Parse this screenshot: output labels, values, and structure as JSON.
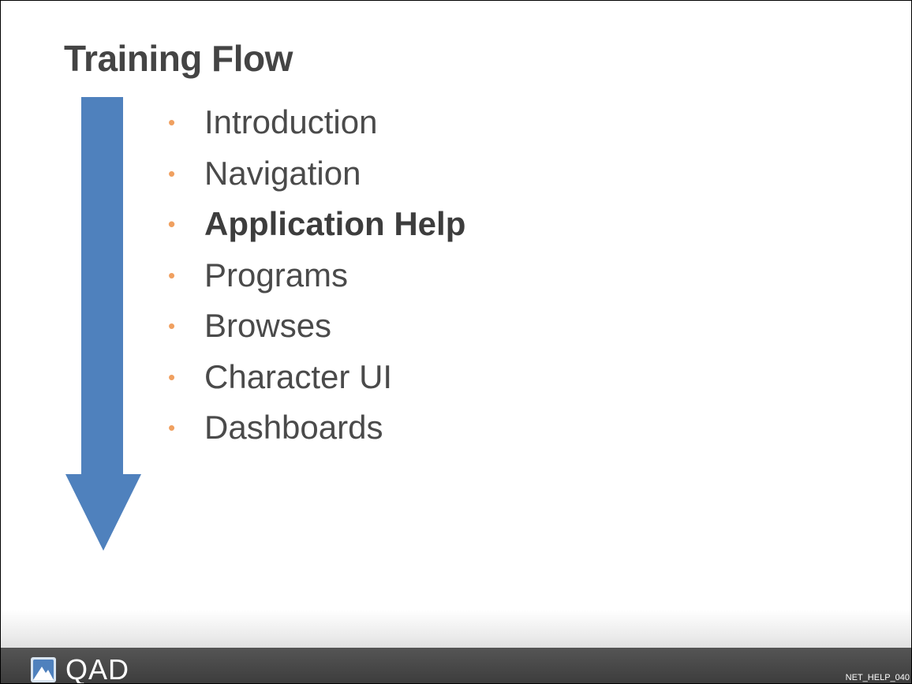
{
  "slide": {
    "title": "Training Flow",
    "bullet_glyph": "•",
    "items": [
      {
        "label": "Introduction",
        "emphasis": false
      },
      {
        "label": "Navigation",
        "emphasis": false
      },
      {
        "label": "Application Help",
        "emphasis": true
      },
      {
        "label": "Programs",
        "emphasis": false
      },
      {
        "label": "Browses",
        "emphasis": false
      },
      {
        "label": "Character UI",
        "emphasis": false
      },
      {
        "label": "Dashboards",
        "emphasis": false
      }
    ]
  },
  "footer": {
    "logo_text": "QAD",
    "slide_code": "NET_HELP_040"
  },
  "colors": {
    "arrow": "#4f81bd",
    "bullet": "#f0a060",
    "footer": "#474747"
  }
}
